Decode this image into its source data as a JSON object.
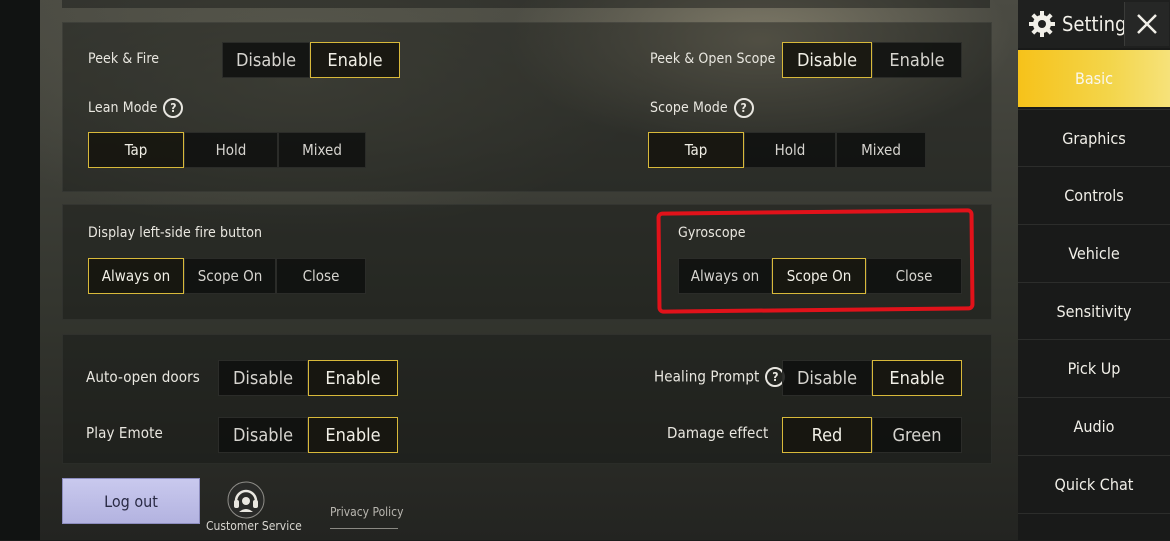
{
  "sidebar": {
    "title": "Settings",
    "items": [
      {
        "label": "Basic",
        "active": true
      },
      {
        "label": "Graphics"
      },
      {
        "label": "Controls"
      },
      {
        "label": "Vehicle"
      },
      {
        "label": "Sensitivity"
      },
      {
        "label": "Pick Up"
      },
      {
        "label": "Audio"
      },
      {
        "label": "Quick Chat"
      }
    ]
  },
  "section1": {
    "peek_fire": {
      "label": "Peek & Fire",
      "options": [
        "Disable",
        "Enable"
      ],
      "selected": "Enable"
    },
    "peek_open_scope": {
      "label": "Peek & Open Scope",
      "options": [
        "Disable",
        "Enable"
      ],
      "selected": "Disable"
    },
    "lean_mode": {
      "label": "Lean Mode",
      "options": [
        "Tap",
        "Hold",
        "Mixed"
      ],
      "selected": "Tap"
    },
    "scope_mode": {
      "label": "Scope Mode",
      "options": [
        "Tap",
        "Hold",
        "Mixed"
      ],
      "selected": "Tap"
    }
  },
  "section2": {
    "left_fire": {
      "label": "Display left-side fire button",
      "options": [
        "Always on",
        "Scope On",
        "Close"
      ],
      "selected": "Always on"
    },
    "gyroscope": {
      "label": "Gyroscope",
      "options": [
        "Always on",
        "Scope On",
        "Close"
      ],
      "selected": "Scope On"
    }
  },
  "section3": {
    "auto_doors": {
      "label": "Auto-open doors",
      "options": [
        "Disable",
        "Enable"
      ],
      "selected": "Enable"
    },
    "healing_prompt": {
      "label": "Healing Prompt",
      "options": [
        "Disable",
        "Enable"
      ],
      "selected": "Enable"
    },
    "play_emote": {
      "label": "Play Emote",
      "options": [
        "Disable",
        "Enable"
      ],
      "selected": "Enable"
    },
    "damage_effect": {
      "label": "Damage effect",
      "options": [
        "Red",
        "Green"
      ],
      "selected": "Red"
    }
  },
  "footer": {
    "logout": "Log out",
    "customer_service": "Customer Service",
    "privacy": "Privacy Policy"
  },
  "colors": {
    "accent": "#f6c21a",
    "selected_border": "#d8b93a",
    "annotation": "#e1121a"
  }
}
